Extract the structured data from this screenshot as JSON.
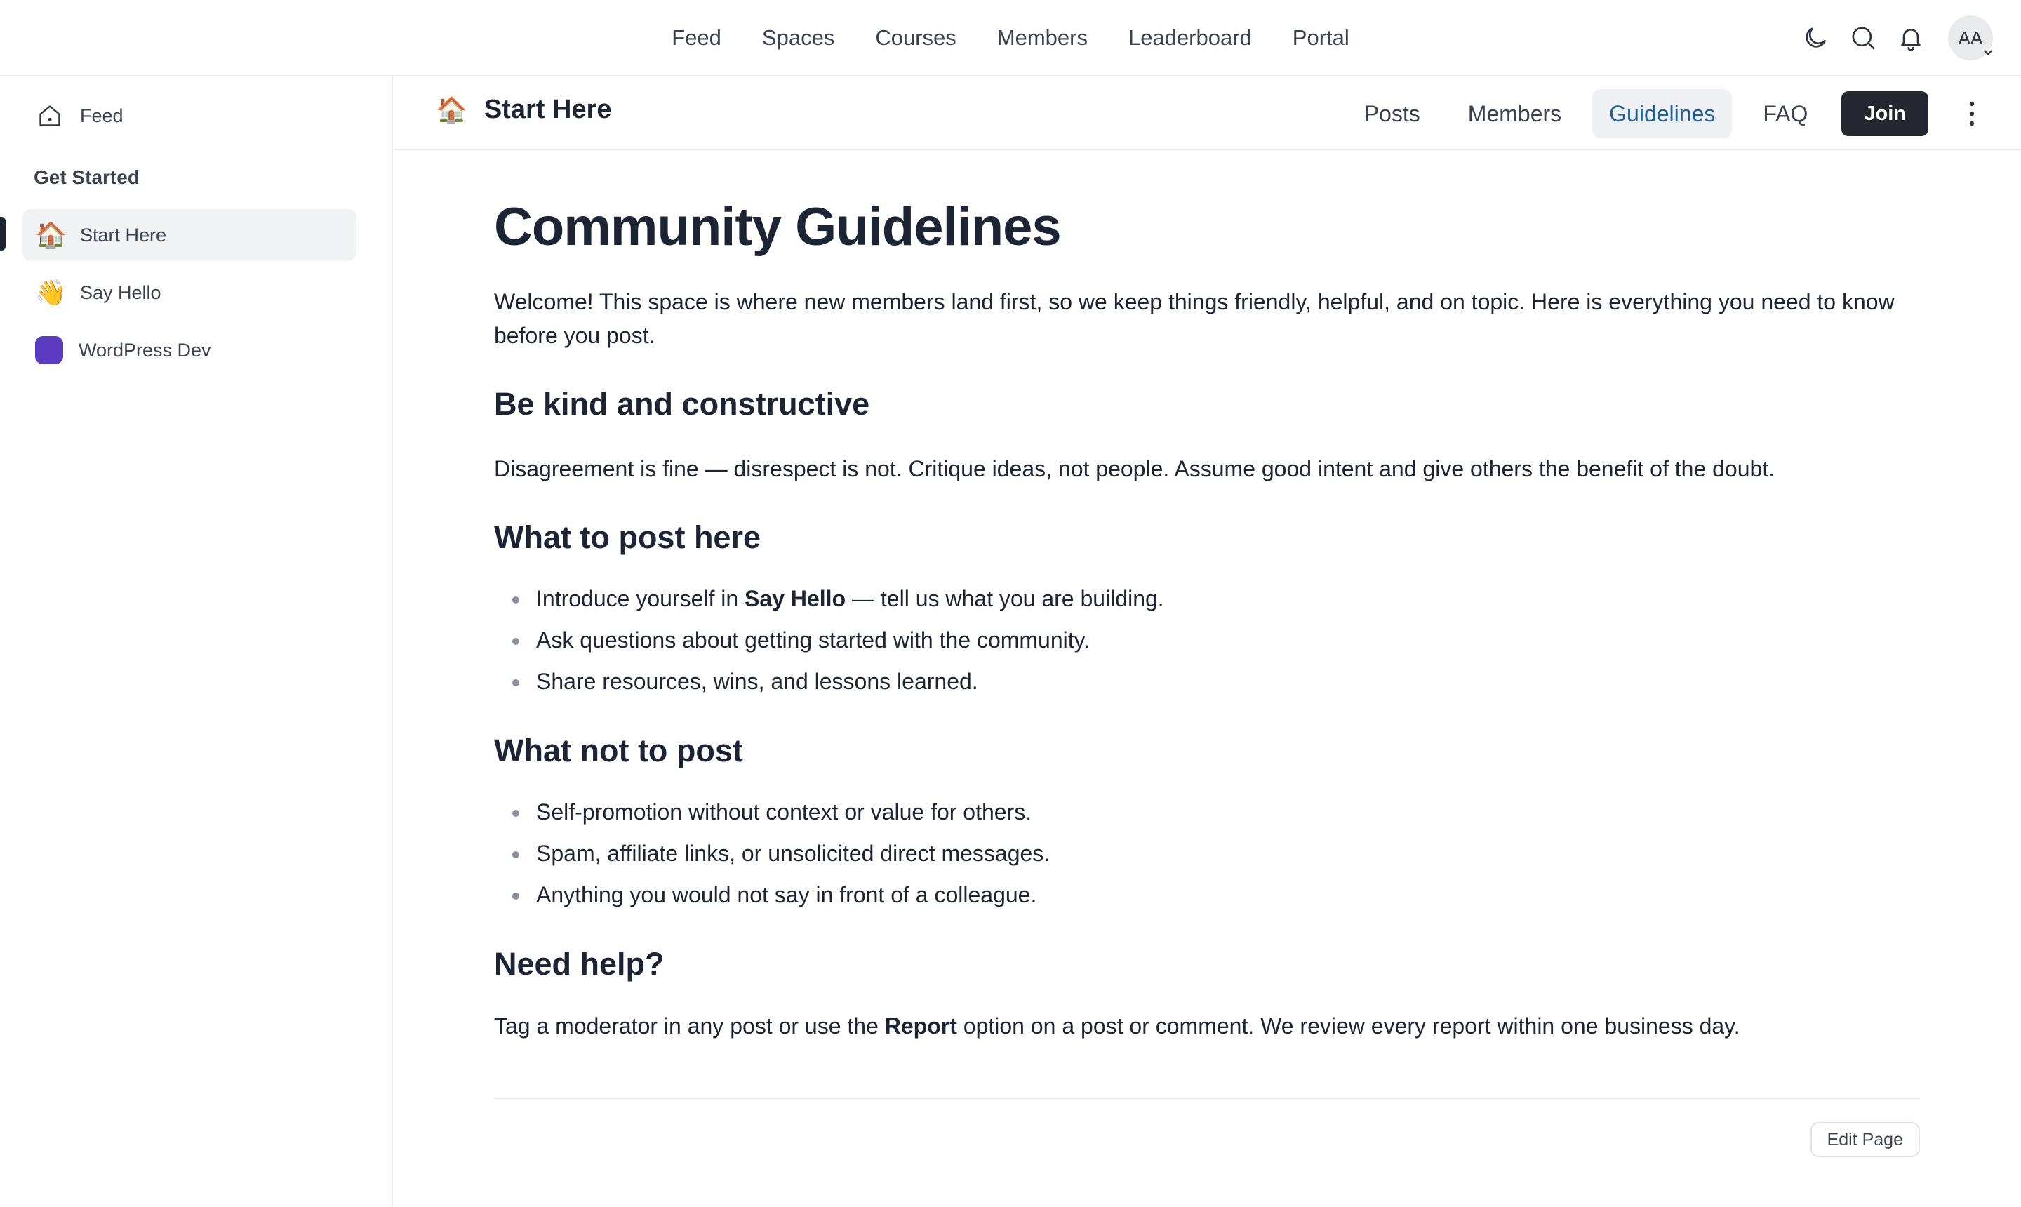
{
  "topnav": {
    "items": [
      "Feed",
      "Spaces",
      "Courses",
      "Members",
      "Leaderboard",
      "Portal"
    ]
  },
  "header_icons": [
    "moon-icon",
    "search-icon",
    "bell-icon"
  ],
  "user": {
    "initials": "AA"
  },
  "sidebar": {
    "feed_label": "Feed",
    "section_heading": "Get Started",
    "items": [
      {
        "icon": "🏠",
        "label": "Start Here",
        "active": true
      },
      {
        "icon": "👋",
        "label": "Say Hello",
        "active": false
      },
      {
        "icon": "purple-square",
        "label": "WordPress Dev",
        "active": false,
        "color": "#5b3bbf"
      }
    ]
  },
  "space": {
    "icon": "🏠",
    "title": "Start Here",
    "tabs": [
      "Posts",
      "Members",
      "Guidelines",
      "FAQ"
    ],
    "active_tab": "Guidelines",
    "join_label": "Join"
  },
  "page": {
    "title": "Community Guidelines",
    "intro": "Welcome! This space is where new members land first, so we keep things friendly, helpful, and on topic. Here is everything you need to know before you post.",
    "sections": [
      {
        "heading": "Be kind and constructive",
        "body": "Disagreement is fine — disrespect is not. Critique ideas, not people. Assume good intent and give others the benefit of the doubt."
      },
      {
        "heading": "What to post here",
        "bullets": [
          {
            "pre": "Introduce yourself in ",
            "bold": "Say Hello",
            "post": " — tell us what you are building."
          },
          {
            "pre": "Ask questions about getting started with the community.",
            "bold": "",
            "post": ""
          },
          {
            "pre": "Share resources, wins, and lessons learned.",
            "bold": "",
            "post": ""
          }
        ]
      },
      {
        "heading": "What not to post",
        "bullets": [
          "Self-promotion without context or value for others.",
          "Spam, affiliate links, or unsolicited direct messages.",
          "Anything you would not say in front of a colleague."
        ]
      },
      {
        "heading": "Need help?",
        "body_pre": "Tag a moderator in any post or use the ",
        "body_bold": "Report",
        "body_post": " option on a post or comment. We review every report within one business day."
      }
    ],
    "edit_label": "Edit Page"
  },
  "colors": {
    "accent_tab": "#1f5f93",
    "join_bg": "#24272d",
    "wordpress_dev": "#5b3bbf"
  }
}
